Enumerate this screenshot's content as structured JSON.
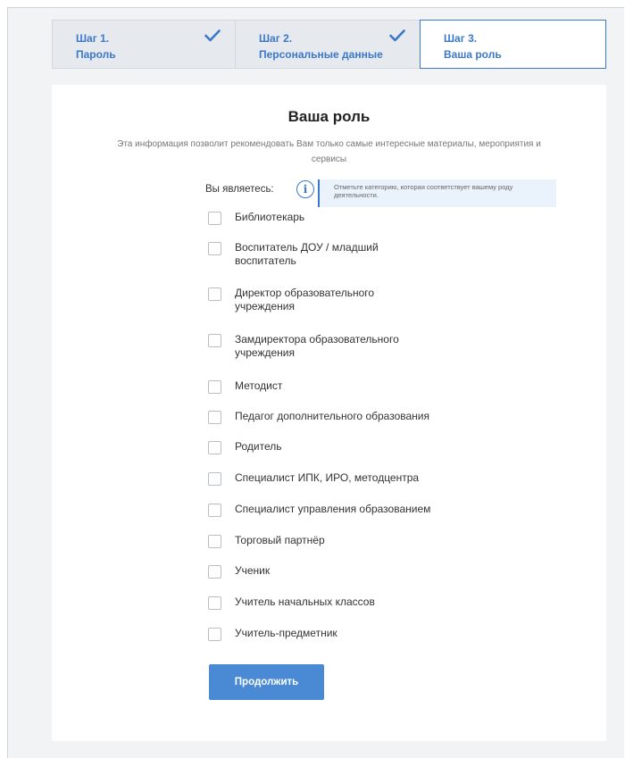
{
  "steps": [
    {
      "label": "Шаг 1.",
      "sub": "Пароль",
      "done": true
    },
    {
      "label": "Шаг 2.",
      "sub": "Персональные данные",
      "done": true
    },
    {
      "label": "Шаг 3.",
      "sub": "Ваша роль",
      "done": false
    }
  ],
  "form": {
    "title": "Ваша роль",
    "subtitle": "Эта информация позволит рекомендовать Вам только самые интересные материалы, мероприятия и сервисы",
    "role_label": "Вы являетесь:",
    "hint": "Отметьте категорию, которая соответствует вашему роду деятельности.",
    "options": [
      {
        "label": "Библиотекарь",
        "checked": false
      },
      {
        "label": "Воспитатель ДОУ / младший воспитатель",
        "checked": false
      },
      {
        "label": "Директор образовательного учреждения",
        "checked": false
      },
      {
        "label": "Замдиректора образовательного учреждения",
        "checked": false
      },
      {
        "label": "Методист",
        "checked": false
      },
      {
        "label": "Педагог дополнительного образования",
        "checked": false
      },
      {
        "label": "Родитель",
        "checked": false
      },
      {
        "label": "Специалист ИПК, ИРО, методцентра",
        "checked": false
      },
      {
        "label": "Специалист управления образованием",
        "checked": false
      },
      {
        "label": "Торговый партнёр",
        "checked": false
      },
      {
        "label": "Ученик",
        "checked": false
      },
      {
        "label": "Учитель начальных классов",
        "checked": false
      },
      {
        "label": "Учитель-предметник",
        "checked": false
      }
    ],
    "submit_label": "Продолжить"
  },
  "colors": {
    "accent": "#3b78c9",
    "button": "#4a8ad4",
    "background": "#f2f3f5"
  }
}
